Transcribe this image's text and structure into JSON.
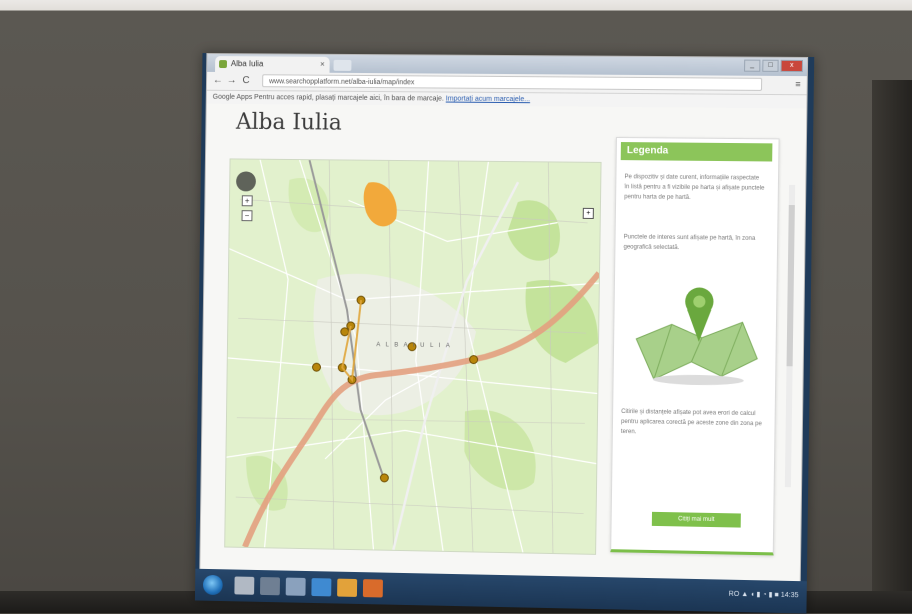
{
  "browser": {
    "tab_title": "Alba Iulia",
    "tab_close": "×",
    "url": "www.searchopplatform.net/alba-iulia/map/index",
    "back": "←",
    "forward": "→",
    "reload": "C",
    "menu": "≡",
    "apps_bar_text": "Google Apps   Pentru acces rapid, plasați marcajele aici, în bara de marcaje.",
    "apps_bar_link": "Importați acum marcajele...",
    "win_min": "_",
    "win_max": "□",
    "win_close": "x"
  },
  "page": {
    "title": "Alba Iulia"
  },
  "map": {
    "city_label": "A L B A   I U L I A",
    "zoom_in": "+",
    "zoom_out": "−",
    "layers_btn": "+",
    "river_color": "#e3a07f",
    "park_color": "#c4e39b",
    "marker_color": "#b8860b",
    "highlight_color": "#f2a93b"
  },
  "sidebar": {
    "heading": "Legenda",
    "paragraph_1": "Pe dispozitiv și date curent, informațiile raspectate în listă pentru a fi vizibile pe harta și afișate punctele pentru harta de pe hartă.",
    "paragraph_2": "Punctele de interes sunt afișate pe hartă, în zona geografică selectată.",
    "paragraph_3": "Citirile și distanțele afișate pot avea erori de calcul pentru aplicarea corectă pe aceste zone din zona pe teren.",
    "button_label": "Citiți mai mult",
    "accent_color": "#8cc55a"
  },
  "taskbar": {
    "tray_text": "RO  ▲  ◖ ▮ ◔ ▮  ■  14:35"
  }
}
